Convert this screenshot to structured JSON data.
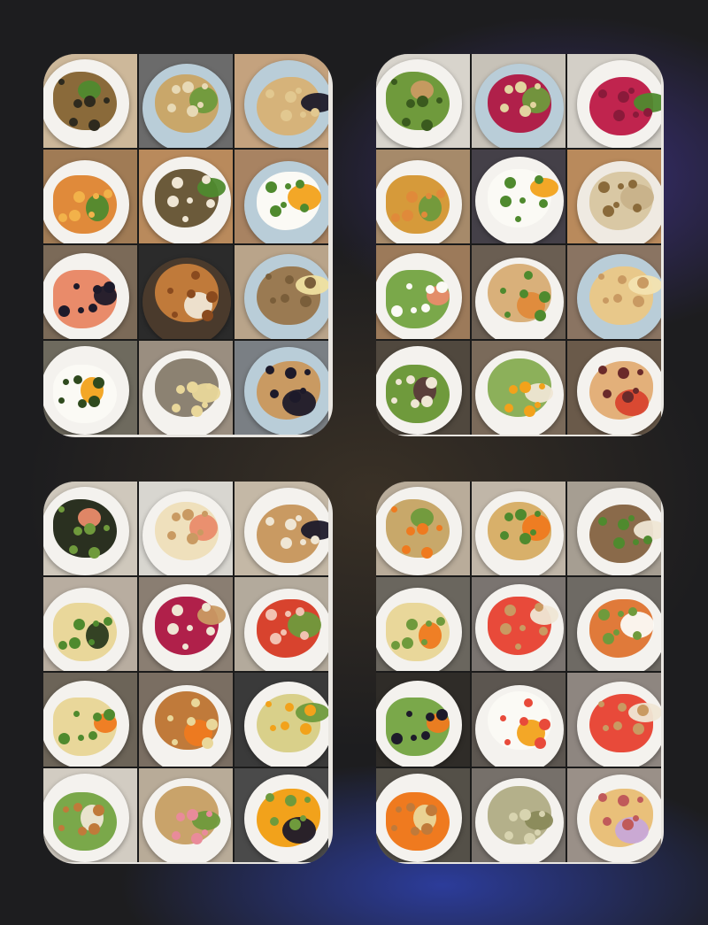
{
  "palette": {
    "plate": "#f4f2ee",
    "plate_blue": "#b9cdd8",
    "table_wood": "#b98a5c",
    "table_dark": "#2b2b2b",
    "pasta": "#e08a3a",
    "greens": "#4f8a2e",
    "egg_white": "#fbfaf5",
    "yolk": "#f2a21b",
    "berries": "#1d1a2a",
    "salmon": "#e98b6a",
    "tomato": "#d8432e",
    "potato": "#e9d79a",
    "bread": "#c99a62",
    "cream": "#efe6d4",
    "beet": "#b0204a",
    "carrot": "#ef7a1f"
  },
  "cards": [
    {
      "id": "top-left",
      "tiles": [
        {
          "bg": "#cdb89a",
          "plate": "#f4f2ee",
          "food": "#8a6a3a",
          "accent": "#4f8a2e",
          "dots": "#2e2a1e"
        },
        {
          "bg": "#6b6b6b",
          "plate": "#b9cdd8",
          "food": "#c9a76a",
          "accent": "#6f9a3c",
          "dots": "#e7d9b5"
        },
        {
          "bg": "#c4a27e",
          "plate": "#b9cdd8",
          "food": "#d6b37a",
          "accent": "#1d1a2a",
          "dots": "#e2c890"
        },
        {
          "bg": "#a07b55",
          "plate": "#f4f2ee",
          "food": "#e08a3a",
          "accent": "#4f8a2e",
          "dots": "#f2b24a"
        },
        {
          "bg": "#b98a5c",
          "plate": "#f4f2ee",
          "food": "#6b5a3a",
          "accent": "#4f8a2e",
          "dots": "#efe6d4"
        },
        {
          "bg": "#a88362",
          "plate": "#b9cdd8",
          "food": "#fbfaf5",
          "accent": "#f2a21b",
          "dots": "#4f8a2e"
        },
        {
          "bg": "#7b6a58",
          "plate": "#f4f2ee",
          "food": "#e98b6a",
          "accent": "#1d1a2a",
          "dots": "#1d1a2a"
        },
        {
          "bg": "#2b2b2b",
          "plate": "#4a3a2c",
          "food": "#c07a3a",
          "accent": "#efe6d4",
          "dots": "#8a4a1e"
        },
        {
          "bg": "#b9a48a",
          "plate": "#b9cdd8",
          "food": "#9a7a52",
          "accent": "#efe0a0",
          "dots": "#7a5e3a"
        },
        {
          "bg": "#6e6a5e",
          "plate": "#f4f2ee",
          "food": "#fbfaf5",
          "accent": "#f2a21b",
          "dots": "#2f4a1e"
        },
        {
          "bg": "#9a8e80",
          "plate": "#f4f2ee",
          "food": "#8c8272",
          "accent": "#e9d79a",
          "dots": "#e9d79a"
        },
        {
          "bg": "#7a7f84",
          "plate": "#b9cdd8",
          "food": "#c99a62",
          "accent": "#1d1a2a",
          "dots": "#1d1a2a"
        }
      ]
    },
    {
      "id": "top-right",
      "tiles": [
        {
          "bg": "#d8d4cc",
          "plate": "#f4f2ee",
          "food": "#6f9a3c",
          "accent": "#c99a62",
          "dots": "#3a5a1e"
        },
        {
          "bg": "#c7c2b8",
          "plate": "#b9cdd8",
          "food": "#b0204a",
          "accent": "#6f9a3c",
          "dots": "#e2d4a0"
        },
        {
          "bg": "#d3cfc7",
          "plate": "#f4f2ee",
          "food": "#c0244e",
          "accent": "#4f8a2e",
          "dots": "#8a1a3a"
        },
        {
          "bg": "#a68a6a",
          "plate": "#f4f2ee",
          "food": "#d69a3a",
          "accent": "#6f9a3c",
          "dots": "#e08a3a"
        },
        {
          "bg": "#444048",
          "plate": "#f4f2ee",
          "food": "#fbfaf5",
          "accent": "#f2a21b",
          "dots": "#4f8a2e"
        },
        {
          "bg": "#b98a5c",
          "plate": "#efeae2",
          "food": "#d9c8a4",
          "accent": "#c8b28a",
          "dots": "#8a6a3a"
        },
        {
          "bg": "#9c7a5a",
          "plate": "#f4f2ee",
          "food": "#7aa84a",
          "accent": "#e98b6a",
          "dots": "#fbfaf5"
        },
        {
          "bg": "#6a5e52",
          "plate": "#f4f2ee",
          "food": "#d9b07a",
          "accent": "#e08a3a",
          "dots": "#4f8a2e"
        },
        {
          "bg": "#8a7462",
          "plate": "#b9cdd8",
          "food": "#e8c88a",
          "accent": "#f3e3b0",
          "dots": "#c99a62"
        },
        {
          "bg": "#50483e",
          "plate": "#f4f2ee",
          "food": "#6f9a3c",
          "accent": "#5a3a3a",
          "dots": "#efe6d4"
        },
        {
          "bg": "#7a6a5a",
          "plate": "#f4f2ee",
          "food": "#8cb05a",
          "accent": "#efe6d4",
          "dots": "#f2a21b"
        },
        {
          "bg": "#6a5a4a",
          "plate": "#f4f2ee",
          "food": "#e3b07a",
          "accent": "#d8432e",
          "dots": "#6a2a2a"
        }
      ]
    },
    {
      "id": "bottom-left",
      "tiles": [
        {
          "bg": "#cfc8bc",
          "plate": "#f4f2ee",
          "food": "#2a3020",
          "accent": "#e98b6a",
          "dots": "#6f9a3c"
        },
        {
          "bg": "#d8d6d0",
          "plate": "#f4f2ee",
          "food": "#efe0bc",
          "accent": "#e98b6a",
          "dots": "#c99a62"
        },
        {
          "bg": "#c4b8a6",
          "plate": "#f4f2ee",
          "food": "#c99a62",
          "accent": "#1d1a2a",
          "dots": "#efe6d4"
        },
        {
          "bg": "#b8ada0",
          "plate": "#f4f2ee",
          "food": "#e9d79a",
          "accent": "#2a3a1e",
          "dots": "#4f8a2e"
        },
        {
          "bg": "#8a7e72",
          "plate": "#f4f2ee",
          "food": "#b0204a",
          "accent": "#c99a62",
          "dots": "#efe6d4"
        },
        {
          "bg": "#b3aa9c",
          "plate": "#f4f2ee",
          "food": "#d8432e",
          "accent": "#6f9a3c",
          "dots": "#f2c2b2"
        },
        {
          "bg": "#6c6458",
          "plate": "#f4f2ee",
          "food": "#e9d79a",
          "accent": "#ef7a1f",
          "dots": "#4f8a2e"
        },
        {
          "bg": "#7a6e62",
          "plate": "#f4f2ee",
          "food": "#c07a3a",
          "accent": "#ef7a1f",
          "dots": "#e9d79a"
        },
        {
          "bg": "#3a3a3a",
          "plate": "#f4f2ee",
          "food": "#d9d08a",
          "accent": "#6f9a3c",
          "dots": "#f2a21b"
        },
        {
          "bg": "#d2ccc2",
          "plate": "#f4f2ee",
          "food": "#7aa84a",
          "accent": "#efe6d4",
          "dots": "#c07a3a"
        },
        {
          "bg": "#b8ab98",
          "plate": "#f4f2ee",
          "food": "#c9a36a",
          "accent": "#6f9a3c",
          "dots": "#e98b9a"
        },
        {
          "bg": "#4a4a4a",
          "plate": "#f4f2ee",
          "food": "#f2a21b",
          "accent": "#1d1a2a",
          "dots": "#6f9a3c"
        }
      ]
    },
    {
      "id": "bottom-right",
      "tiles": [
        {
          "bg": "#b9ac9a",
          "plate": "#f4f2ee",
          "food": "#c8a86a",
          "accent": "#6f9a3c",
          "dots": "#ef7a1f"
        },
        {
          "bg": "#c0b6a8",
          "plate": "#f4f2ee",
          "food": "#d8b06a",
          "accent": "#ef7a1f",
          "dots": "#4f8a2e"
        },
        {
          "bg": "#a69e92",
          "plate": "#f4f2ee",
          "food": "#8a6a4a",
          "accent": "#efe6d4",
          "dots": "#4f8a2e"
        },
        {
          "bg": "#6a665e",
          "plate": "#f4f2ee",
          "food": "#e9d79a",
          "accent": "#ef7a1f",
          "dots": "#6f9a3c"
        },
        {
          "bg": "#7a7470",
          "plate": "#f4f2ee",
          "food": "#e84a3a",
          "accent": "#efe6d4",
          "dots": "#c99a62"
        },
        {
          "bg": "#6e6a64",
          "plate": "#f4f2ee",
          "food": "#e07a3a",
          "accent": "#fbfaf5",
          "dots": "#6f9a3c"
        },
        {
          "bg": "#2f2c28",
          "plate": "#f4f2ee",
          "food": "#7aa84a",
          "accent": "#ef7a1f",
          "dots": "#1d1a2a"
        },
        {
          "bg": "#5c5650",
          "plate": "#f4f2ee",
          "food": "#fbfaf5",
          "accent": "#f2a21b",
          "dots": "#e84a3a"
        },
        {
          "bg": "#8e8680",
          "plate": "#f4f2ee",
          "food": "#e84a3a",
          "accent": "#efe6d4",
          "dots": "#c99a62"
        },
        {
          "bg": "#545048",
          "plate": "#f4f2ee",
          "food": "#ef7a1f",
          "accent": "#e9d79a",
          "dots": "#c07a3a"
        },
        {
          "bg": "#76706a",
          "plate": "#f4f2ee",
          "food": "#b4b08a",
          "accent": "#8a8a5a",
          "dots": "#d8d4b0"
        },
        {
          "bg": "#9a9088",
          "plate": "#f4f2ee",
          "food": "#e9c07a",
          "accent": "#c8a8d8",
          "dots": "#c05a5a"
        }
      ]
    }
  ]
}
